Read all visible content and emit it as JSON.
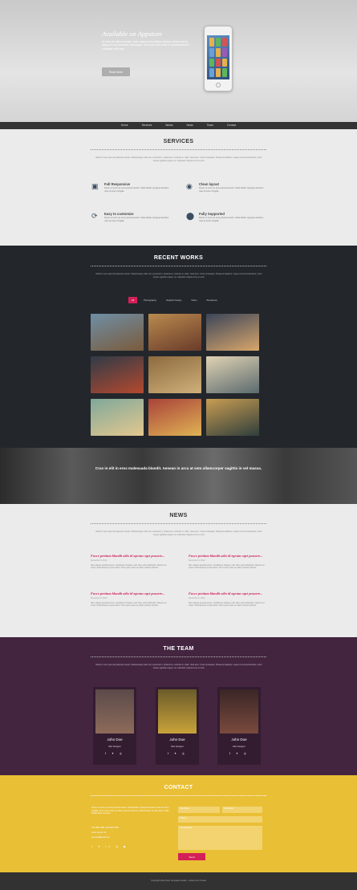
{
  "hero": {
    "title": "Available on Appstore",
    "text": "Ut enim ad minim veniam, quis nostrud exercitation ullamco laboris nisi ut aliquip ex ea commodo consequat. Duis aute irure dolor in reprehenderit in voluptate velit esse.",
    "button": "Read More"
  },
  "nav": [
    "Home",
    "Services",
    "Works",
    "News",
    "Team",
    "Contact"
  ],
  "services": {
    "title": "SERVICES",
    "lead": "Morbi in sem quis dui placerat ornare. Pellentesque odio nisi, euismod in, pharetra a, ultricies in, diam. Sed arcu. Cras consequat. Praesent dapibus, neque id cursus faucibus, tortor neque egestas augue, eu vulputate magna eros eu erat.",
    "items": [
      {
        "icon": "tablet-icon",
        "title": "Full Responsive",
        "text": "Donec ut enim ac eros pulvinar iaculis. Nulla facilisi. Quisque faucibus risus id lorem fringilla."
      },
      {
        "icon": "bulb-icon",
        "title": "Clean layout",
        "text": "Donec ut enim ac eros pulvinar iaculis. Nulla facilisi. Quisque faucibus risus id lorem fringilla."
      },
      {
        "icon": "refresh-icon",
        "title": "Easy to customize",
        "text": "Donec ut enim ac eros pulvinar iaculis. Nulla facilisi. Quisque faucibus risus id lorem fringilla."
      },
      {
        "icon": "map-pin-icon",
        "title": "Fully Supported",
        "text": "Donec ut enim ac eros pulvinar iaculis. Nulla facilisi. Quisque faucibus risus id lorem fringilla."
      }
    ]
  },
  "works": {
    "title": "RECENT WORKS",
    "lead": "Morbi in sem quis dui placerat ornare. Pellentesque odio nisi, euismod in, pharetra a, ultricies in, diam. Sed arcu. Cras consequat. Praesent dapibus, neque id cursus faucibus, tortor neque egestas augue, eu vulputate magna eros eu erat.",
    "filters": [
      "All",
      "Photography",
      "Graphic Design",
      "Video",
      "Wordpress"
    ],
    "thumb_colors": [
      [
        "#6e8fa6",
        "#7a5a3b"
      ],
      [
        "#b98a4e",
        "#6a3b2a"
      ],
      [
        "#3b4559",
        "#d9a66b"
      ],
      [
        "#2f3b47",
        "#b5492f"
      ],
      [
        "#8d6a3e",
        "#cfb07a"
      ],
      [
        "#e0d3b4",
        "#5b6a6e"
      ],
      [
        "#7fa89a",
        "#e4c88f"
      ],
      [
        "#a9433a",
        "#e0b354"
      ],
      [
        "#c99d52",
        "#2f3e3c"
      ]
    ]
  },
  "quote": {
    "text": "Cras in elit in eros malesuada blandit. Aenean in arcu at sem ullamcorper sagittis in vel massa."
  },
  "news": {
    "title": "NEWS",
    "lead": "Morbi in sem quis dui placerat ornare. Pellentesque odio nisi, euismod in, pharetra a, ultricies in, diam. Sed arcu. Cras consequat. Praesent dapibus, neque id cursus faucibus, tortor neque egestas augue, eu vulputate magna eros eu erat.",
    "items": [
      {
        "title": "Fusce pretium blandit odio id egestas eget posuere...",
        "date": "November 6, 2012",
        "text": "Nam aliquet gravida lectus. Vestibulum tristique velit. Nam velit sollicitudin. Mauris vel turpis. Pellentesque id quis tellus. Proin quis metus ac diam pulvinar lobortis."
      },
      {
        "title": "Fusce pretium blandit odio id egestas eget posuere...",
        "date": "November 6, 2012",
        "text": "Nam aliquet gravida lectus. Vestibulum tristique velit. Nam velit sollicitudin. Mauris vel turpis. Pellentesque id quis tellus. Proin quis metus ac diam pulvinar lobortis."
      },
      {
        "title": "Fusce pretium blandit odio id egestas eget posuere...",
        "date": "November 6, 2012",
        "text": "Nam aliquet gravida lectus. Vestibulum tristique velit. Nam velit sollicitudin. Mauris vel turpis. Pellentesque id quis tellus. Proin quis metus ac diam pulvinar lobortis."
      },
      {
        "title": "Fusce pretium blandit odio id egestas eget posuere...",
        "date": "November 6, 2012",
        "text": "Nam aliquet gravida lectus. Vestibulum tristique velit. Nam velit sollicitudin. Mauris vel turpis. Pellentesque id quis tellus. Proin quis metus ac diam pulvinar lobortis."
      }
    ]
  },
  "team": {
    "title": "THE TEAM",
    "lead": "Morbi in sem quis dui placerat ornare. Pellentesque odio nisi, euismod in, pharetra a, ultricies in, diam. Sed arcu. Cras consequat. Praesent dapibus, neque id cursus faucibus, tortor neque egestas augue, eu vulputate magna eros eu erat.",
    "members": [
      {
        "name": "John Doe",
        "role": "Web Designer",
        "social": "f ✦ ◎",
        "photo": "#8d6b5a"
      },
      {
        "name": "John Doe",
        "role": "Web Designer",
        "social": "f ✦ ◎",
        "photo": "#c9a33a"
      },
      {
        "name": "John Doe",
        "role": "Web Designer",
        "social": "f ✦ ◎",
        "photo": "#7a4a3e"
      }
    ]
  },
  "contact": {
    "title": "CONTACT",
    "text": "Donec ut enim ac eros pulvinar iaculis. Nulla facilisi. Quisque faucibus risus id lorem fringilla. Proin quis metus ac diam pulvinar lobortis. Pellentesque id quis tellus. Nulla facilisi dolor sit amet.",
    "phone": "123-456-7890, 123-456-7890",
    "address": "Lorem ipsum 12",
    "email": "yourmail@mail.com",
    "social": "f ✦ in ◎ ▶",
    "name_ph": "Your Name",
    "email_ph": "Your Email",
    "subject_ph": "Subject",
    "message_ph": "Your Message",
    "send": "Send"
  },
  "footer": {
    "text": "Copyright 2012 Deer Templates Studio - Collect from Studio"
  },
  "colors": {
    "accent": "#d32058",
    "dark": "#23272c",
    "team": "#43253f",
    "contact": "#e9bf35"
  }
}
